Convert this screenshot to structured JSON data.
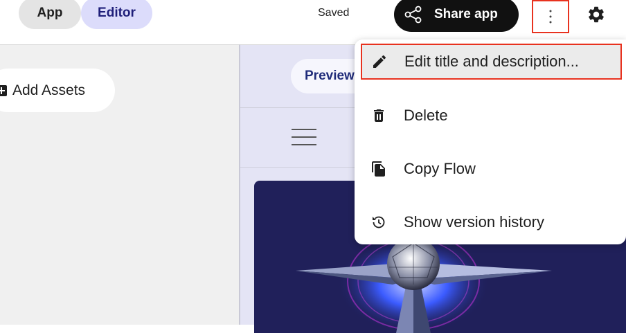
{
  "header": {
    "mode_tabs": [
      {
        "label": "App"
      },
      {
        "label": "Editor"
      }
    ],
    "save_status": "Saved",
    "share_label": "Share app",
    "more_icon": "more-vert-icon",
    "settings_icon": "gear-icon"
  },
  "left_panel": {
    "add_assets_label": "Add Assets"
  },
  "preview": {
    "tab_label": "Preview"
  },
  "menu": {
    "items": [
      {
        "label": "Edit title and description...",
        "icon": "pencil-icon"
      },
      {
        "label": "Delete",
        "icon": "trash-icon"
      },
      {
        "label": "Copy Flow",
        "icon": "copy-icon"
      },
      {
        "label": "Show version history",
        "icon": "history-icon"
      }
    ]
  },
  "colors": {
    "highlight": "#e8321f",
    "editor_tab_bg": "#dcdcfb",
    "share_bg": "#111111",
    "artwork_bg": "#20205a"
  }
}
